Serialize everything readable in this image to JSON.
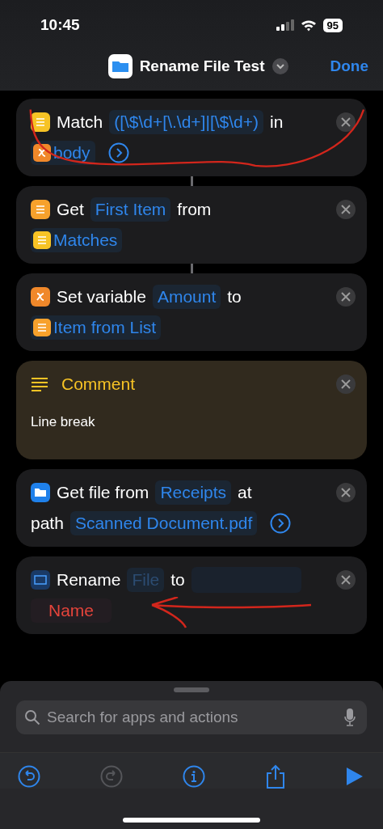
{
  "status_bar": {
    "time": "10:45",
    "battery": "95"
  },
  "header": {
    "title": "Rename File Test",
    "done": "Done"
  },
  "actions": [
    {
      "kind": "text",
      "connected": true,
      "annotated": true,
      "lines": [
        [
          {
            "kind": "word",
            "text": "Match"
          },
          {
            "kind": "token",
            "text": "([\\$\\d+[\\.\\d+]|[\\$\\d+)"
          },
          {
            "kind": "word",
            "text": "in"
          }
        ],
        [
          {
            "kind": "variable",
            "text": "body"
          },
          {
            "kind": "more"
          }
        ]
      ]
    },
    {
      "kind": "list",
      "connected": true,
      "annotated": false,
      "lines": [
        [
          {
            "kind": "word",
            "text": "Get"
          },
          {
            "kind": "token",
            "text": "First Item"
          },
          {
            "kind": "word",
            "text": "from"
          }
        ],
        [
          {
            "kind": "textresult",
            "text": "Matches"
          }
        ]
      ]
    },
    {
      "kind": "variable",
      "connected": false,
      "annotated": false,
      "lines": [
        [
          {
            "kind": "word",
            "text": "Set variable"
          },
          {
            "kind": "token",
            "text": "Amount"
          },
          {
            "kind": "word",
            "text": "to"
          }
        ],
        [
          {
            "kind": "listresult",
            "text": "Item from List"
          }
        ]
      ]
    },
    {
      "kind": "comment",
      "title": "Comment",
      "body": "Line break"
    },
    {
      "kind": "folder",
      "connected": false,
      "annotated": false,
      "lines": [
        [
          {
            "kind": "word",
            "text": "Get file from"
          },
          {
            "kind": "token",
            "text": "Receipts"
          },
          {
            "kind": "word",
            "text": "at"
          }
        ],
        [
          {
            "kind": "word",
            "text": "path"
          },
          {
            "kind": "token",
            "text": "Scanned Document.pdf"
          },
          {
            "kind": "more"
          }
        ]
      ]
    },
    {
      "kind": "rename",
      "connected": false,
      "annotated": true,
      "lines": [
        [
          {
            "kind": "word",
            "text": "Rename"
          },
          {
            "kind": "dim",
            "text": "File"
          },
          {
            "kind": "word",
            "text": "to"
          },
          {
            "kind": "empty"
          }
        ],
        [
          {
            "kind": "warning",
            "text": "Name"
          }
        ]
      ]
    }
  ],
  "search": {
    "placeholder": "Search for apps and actions"
  },
  "toolbar": [
    {
      "kind": "undo",
      "disabled": false
    },
    {
      "kind": "redo",
      "disabled": true
    },
    {
      "kind": "info",
      "disabled": false
    },
    {
      "kind": "share",
      "disabled": false
    },
    {
      "kind": "run",
      "disabled": false
    }
  ]
}
